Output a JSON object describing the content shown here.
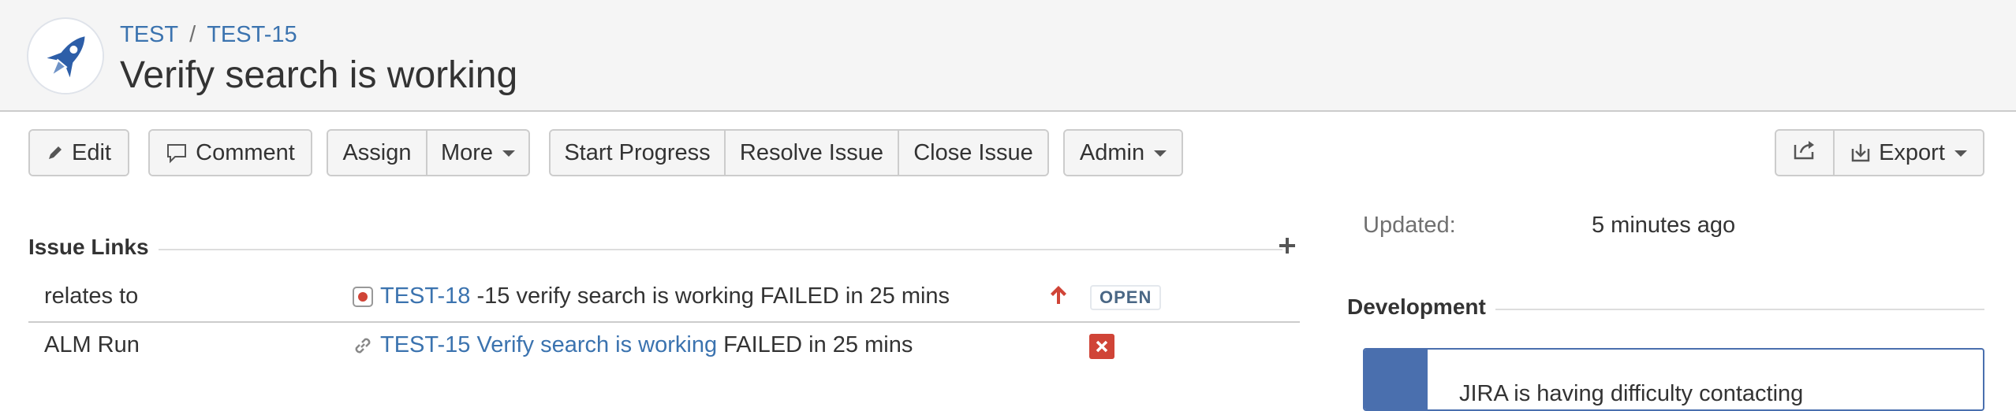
{
  "header": {
    "project_link": "TEST",
    "separator": "/",
    "issue_key": "TEST-15",
    "title": "Verify search is working"
  },
  "toolbar": {
    "edit": "Edit",
    "comment": "Comment",
    "assign": "Assign",
    "more": "More",
    "start_progress": "Start Progress",
    "resolve_issue": "Resolve Issue",
    "close_issue": "Close Issue",
    "admin": "Admin",
    "export": "Export"
  },
  "issue_links": {
    "title": "Issue Links",
    "rows": [
      {
        "relation": "relates to",
        "key": "TEST-18",
        "summary": "-15 verify search is working FAILED in 25 mins",
        "status": "OPEN"
      },
      {
        "relation": "ALM Run",
        "link_text": "TEST-15 Verify search is working",
        "suffix": "FAILED in 25 mins"
      }
    ]
  },
  "details": {
    "updated_label": "Updated:",
    "updated_value": "5 minutes ago"
  },
  "development": {
    "title": "Development",
    "message": "JIRA is having difficulty contacting"
  },
  "colors": {
    "link": "#3b73af",
    "status_open": "#4a6785",
    "priority_up": "#d04437",
    "failed": "#d04437",
    "panel_accent": "#4a6fae"
  }
}
